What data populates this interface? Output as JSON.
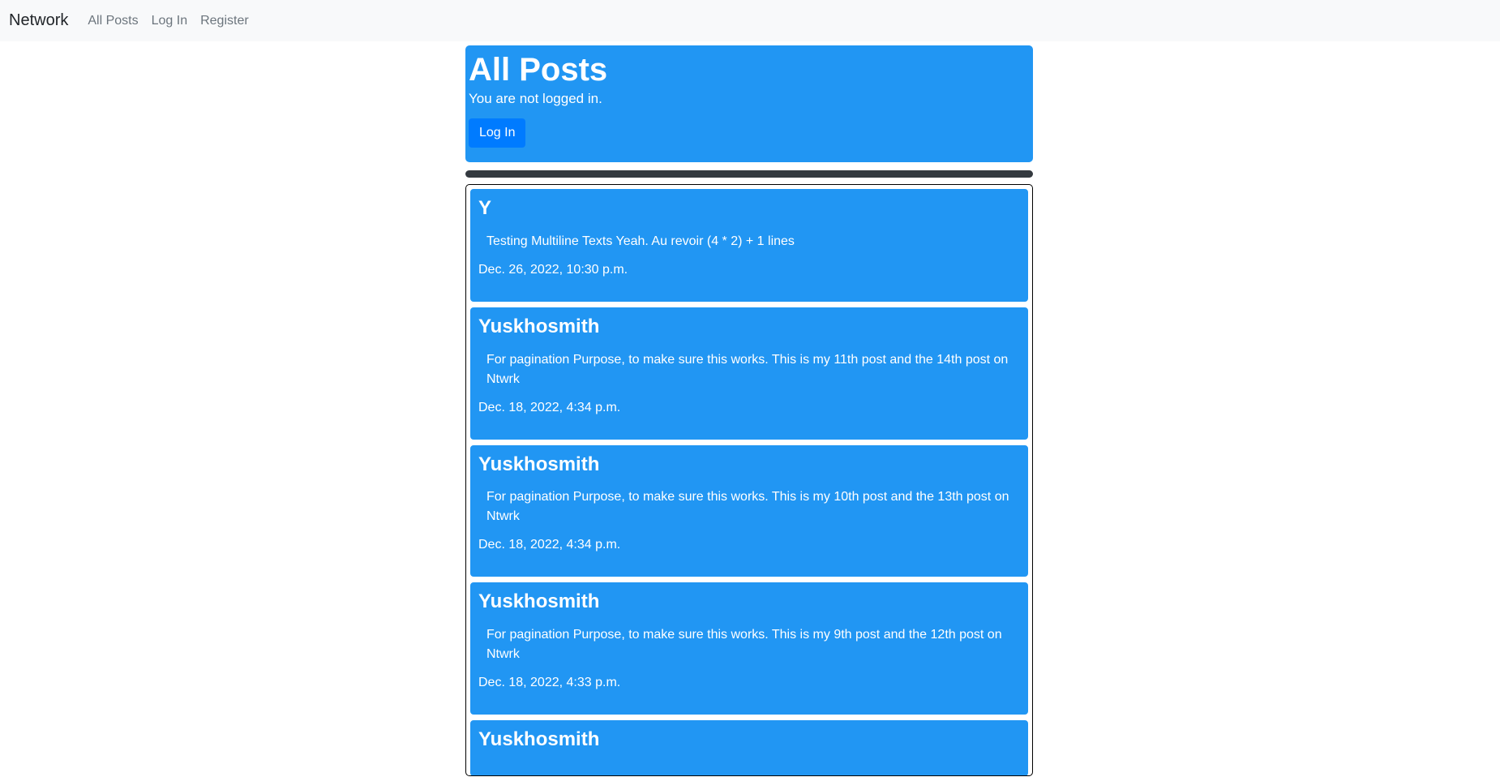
{
  "navbar": {
    "brand": "Network",
    "links": [
      "All Posts",
      "Log In",
      "Register"
    ]
  },
  "header": {
    "title": "All Posts",
    "status": "You are not logged in.",
    "login_button": "Log In"
  },
  "posts": [
    {
      "author": "Y",
      "body": "Testing Multiline Texts Yeah. Au revoir (4 * 2) + 1 lines",
      "date": "Dec. 26, 2022, 10:30 p.m."
    },
    {
      "author": "Yuskhosmith",
      "body": "For pagination Purpose, to make sure this works. This is my 11th post and the 14th post on Ntwrk",
      "date": "Dec. 18, 2022, 4:34 p.m."
    },
    {
      "author": "Yuskhosmith",
      "body": "For pagination Purpose, to make sure this works. This is my 10th post and the 13th post on Ntwrk",
      "date": "Dec. 18, 2022, 4:34 p.m."
    },
    {
      "author": "Yuskhosmith",
      "body": "For pagination Purpose, to make sure this works. This is my 9th post and the 12th post on Ntwrk",
      "date": "Dec. 18, 2022, 4:33 p.m."
    },
    {
      "author": "Yuskhosmith",
      "body": "",
      "date": ""
    }
  ],
  "colors": {
    "card_blue": "#2196f3",
    "button_blue": "#007bff",
    "navbar_bg": "#f8f9fa",
    "divider": "#343a40"
  }
}
